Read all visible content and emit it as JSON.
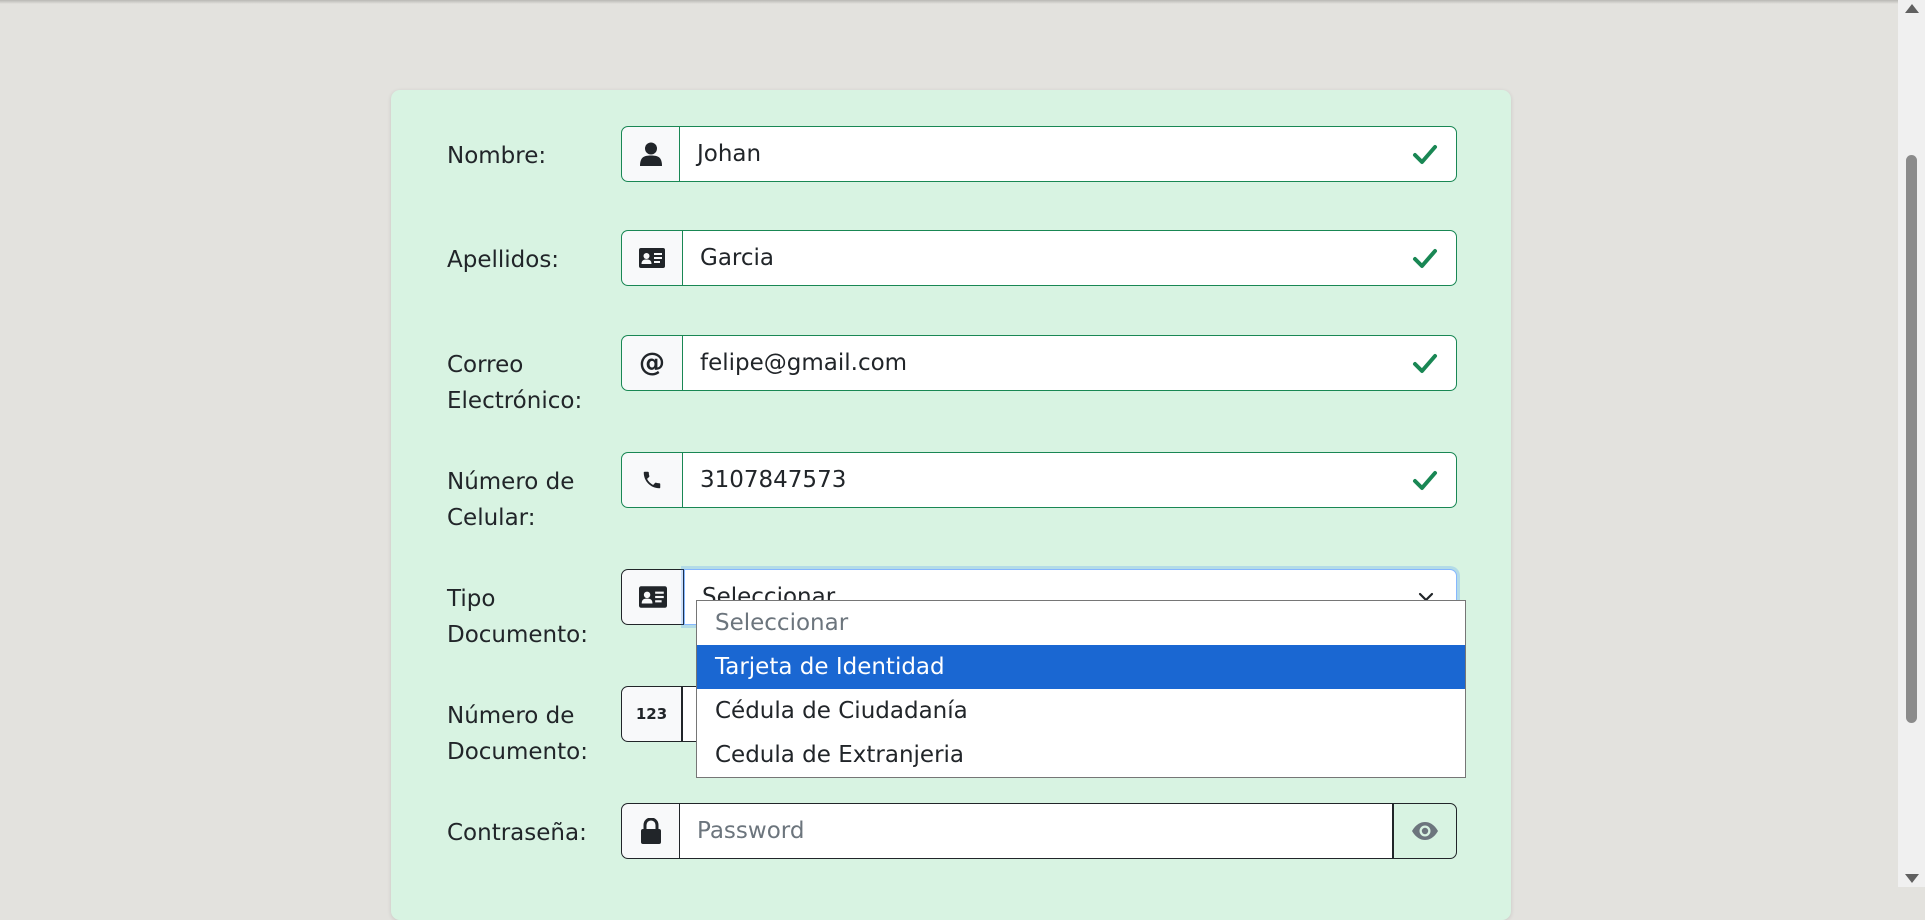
{
  "form": {
    "nombre": {
      "label": "Nombre:",
      "value": "Johan",
      "icon": "user-icon",
      "valid": true
    },
    "apellidos": {
      "label": "Apellidos:",
      "value": "Garcia",
      "icon": "id-card-icon",
      "valid": true
    },
    "correo": {
      "label_line1": "Correo",
      "label_line2": "Electrónico:",
      "value": "felipe@gmail.com",
      "icon": "at-icon",
      "valid": true
    },
    "celular": {
      "label_line1": "Número de",
      "label_line2": "Celular:",
      "value": "3107847573",
      "icon": "phone-icon",
      "valid": true
    },
    "tipo_documento": {
      "label_line1": "Tipo",
      "label_line2": "Documento:",
      "value": "Seleccionar",
      "icon": "id-card-icon"
    },
    "numero_documento": {
      "label_line1": "Número de",
      "label_line2": "Documento:",
      "icon_text": "123"
    },
    "contrasena": {
      "label": "Contraseña:",
      "placeholder": "Password",
      "icon": "lock-icon"
    }
  },
  "dropdown": {
    "options": [
      {
        "label": "Seleccionar",
        "state": "placeholder"
      },
      {
        "label": "Tarjeta de Identidad",
        "state": "highlighted"
      },
      {
        "label": "Cédula de Ciudadanía",
        "state": "normal"
      },
      {
        "label": "Cedula de Extranjeria",
        "state": "normal"
      }
    ]
  },
  "colors": {
    "card_bg": "#d8f3e2",
    "page_bg": "#e3e2de",
    "valid_green": "#198754",
    "highlight_blue": "#1a67d2"
  }
}
